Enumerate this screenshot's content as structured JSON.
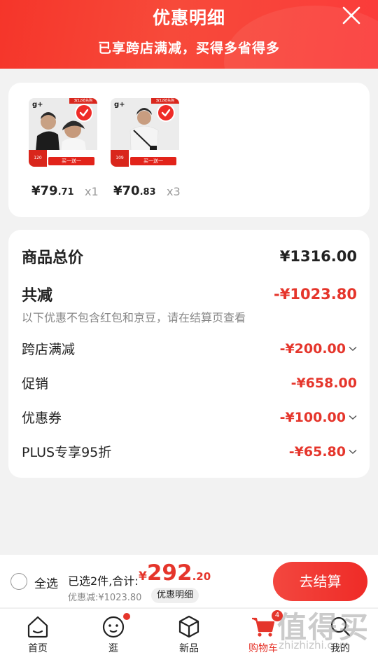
{
  "header": {
    "title": "优惠明细",
    "subtitle": "已享跨店满减，买得多省得多",
    "close_icon": "close-icon"
  },
  "products": [
    {
      "logo": "g+",
      "tag": "双12抢先购",
      "promo_price": "120",
      "promo_text": "买一送一",
      "price_int": "¥79",
      "price_dec": ".71",
      "qty": "x1",
      "selected": true
    },
    {
      "logo": "g+",
      "tag": "双12抢先购",
      "promo_price": "109",
      "promo_text": "买一送一",
      "price_int": "¥70",
      "price_dec": ".83",
      "qty": "x3",
      "selected": true
    }
  ],
  "detail": {
    "total_label": "商品总价",
    "total_value": "¥1316.00",
    "reduce_label": "共减",
    "reduce_value": "-¥1023.80",
    "note": "以下优惠不包含红包和京豆，请在结算页查看",
    "items": [
      {
        "label": "跨店满减",
        "value": "-¥200.00",
        "expandable": true
      },
      {
        "label": "促销",
        "value": "-¥658.00",
        "expandable": false
      },
      {
        "label": "优惠券",
        "value": "-¥100.00",
        "expandable": true
      },
      {
        "label": "PLUS专享95折",
        "value": "-¥65.80",
        "expandable": true
      }
    ]
  },
  "checkout": {
    "select_all": "全选",
    "summary": "已选2件,合计:",
    "amount_currency": "¥",
    "amount_int": "292",
    "amount_dec": ".20",
    "discount_text": "优惠减:¥1023.80",
    "detail_pill": "优惠明细",
    "pay_button": "去结算"
  },
  "tabs": [
    {
      "label": "首页",
      "icon": "home-icon"
    },
    {
      "label": "逛",
      "icon": "face-icon",
      "dot": true
    },
    {
      "label": "新品",
      "icon": "box-icon"
    },
    {
      "label": "购物车",
      "icon": "cart-icon",
      "badge": "4",
      "active": true
    },
    {
      "label": "我的",
      "icon": "search-person-icon"
    }
  ],
  "watermark": {
    "big": "值得买",
    "small": "zhizhizhi.com"
  },
  "colors": {
    "accent": "#e5352b",
    "header": "#f5352a"
  }
}
